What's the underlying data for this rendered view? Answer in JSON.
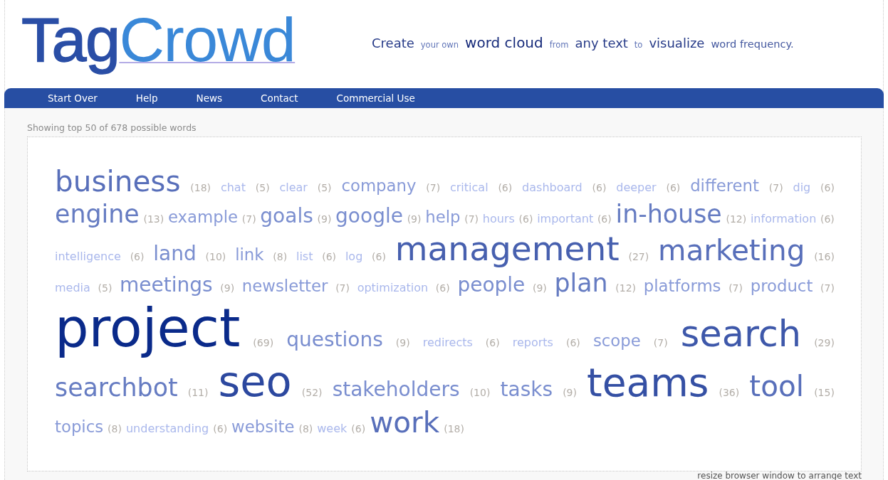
{
  "logo": {
    "parts": [
      "Tag",
      "Crowd"
    ]
  },
  "tagline": [
    {
      "text": "Create",
      "kind": "major"
    },
    {
      "text": "your own",
      "kind": "minor"
    },
    {
      "text": "word cloud",
      "kind": "top"
    },
    {
      "text": "from",
      "kind": "minor"
    },
    {
      "text": "any text",
      "kind": "major"
    },
    {
      "text": "to",
      "kind": "minor"
    },
    {
      "text": "visualize",
      "kind": "major"
    },
    {
      "text": "word frequency.",
      "kind": "mid"
    }
  ],
  "nav": [
    "Start Over",
    "Help",
    "News",
    "Contact",
    "Commercial Use"
  ],
  "summary": "Showing top 50 of 678 possible words",
  "cloud": {
    "lines": [
      {
        "words": [
          {
            "word": "business",
            "count": "(18)",
            "kind": "larger"
          },
          {
            "word": "chat",
            "count": "(5)",
            "kind": "minimal"
          },
          {
            "word": "clear",
            "count": "(5)",
            "kind": "minimal"
          },
          {
            "word": "company",
            "count": "(7)",
            "kind": "small"
          },
          {
            "word": "critical",
            "count": "(6)",
            "kind": "minimal"
          },
          {
            "word": "dashboard",
            "count": "(6)",
            "kind": "minimal"
          },
          {
            "word": "deeper",
            "count": "(6)",
            "kind": "minimal"
          },
          {
            "word": "different",
            "count": "(7)",
            "kind": "small"
          },
          {
            "word": "dig",
            "count": "(6)",
            "kind": "minimal"
          }
        ]
      },
      {
        "words": [
          {
            "word": "engine",
            "count": "(13)",
            "kind": "large"
          },
          {
            "word": "example",
            "count": "(7)",
            "kind": "small"
          },
          {
            "word": "goals",
            "count": "(9)",
            "kind": "medium"
          },
          {
            "word": "google",
            "count": "(9)",
            "kind": "medium"
          },
          {
            "word": "help",
            "count": "(7)",
            "kind": "small"
          },
          {
            "word": "hours",
            "count": "(6)",
            "kind": "minimal"
          },
          {
            "word": "important",
            "count": "(6)",
            "kind": "minimal"
          },
          {
            "word": "in-house",
            "count": "(12)",
            "kind": "large"
          },
          {
            "word": "information",
            "count": "(6)",
            "kind": "minimal"
          }
        ]
      },
      {
        "words": [
          {
            "word": "intelligence",
            "count": "(6)",
            "kind": "minimal"
          },
          {
            "word": "land",
            "count": "(10)",
            "kind": "medium"
          },
          {
            "word": "link",
            "count": "(8)",
            "kind": "small"
          },
          {
            "word": "list",
            "count": "(6)",
            "kind": "minimal"
          },
          {
            "word": "log",
            "count": "(6)",
            "kind": "minimal"
          },
          {
            "word": "management",
            "count": "(27)",
            "kind": "big"
          },
          {
            "word": "marketing",
            "count": "(16)",
            "kind": "larger"
          }
        ]
      },
      {
        "words": [
          {
            "word": "media",
            "count": "(5)",
            "kind": "minimal"
          },
          {
            "word": "meetings",
            "count": "(9)",
            "kind": "medium"
          },
          {
            "word": "newsletter",
            "count": "(7)",
            "kind": "small"
          },
          {
            "word": "optimization",
            "count": "(6)",
            "kind": "minimal"
          },
          {
            "word": "people",
            "count": "(9)",
            "kind": "medium"
          },
          {
            "word": "plan",
            "count": "(12)",
            "kind": "large"
          },
          {
            "word": "platforms",
            "count": "(7)",
            "kind": "small"
          },
          {
            "word": "product",
            "count": "(7)",
            "kind": "small"
          }
        ]
      },
      {
        "words": [
          {
            "word": "project",
            "count": "(69)",
            "kind": "top"
          },
          {
            "word": "questions",
            "count": "(9)",
            "kind": "medium"
          },
          {
            "word": "redirects",
            "count": "(6)",
            "kind": "minimal"
          },
          {
            "word": "reports",
            "count": "(6)",
            "kind": "minimal"
          },
          {
            "word": "scope",
            "count": "(7)",
            "kind": "small"
          },
          {
            "word": "search",
            "count": "(29)",
            "kind": "bigger"
          }
        ]
      },
      {
        "words": [
          {
            "word": "searchbot",
            "count": "(11)",
            "kind": "large"
          },
          {
            "word": "seo",
            "count": "(52)",
            "kind": "giant"
          },
          {
            "word": "stakeholders",
            "count": "(10)",
            "kind": "medium"
          },
          {
            "word": "tasks",
            "count": "(9)",
            "kind": "medium"
          },
          {
            "word": "teams",
            "count": "(36)",
            "kind": "huge"
          },
          {
            "word": "tool",
            "count": "(15)",
            "kind": "larger"
          }
        ]
      },
      {
        "words": [
          {
            "word": "topics",
            "count": "(8)",
            "kind": "small"
          },
          {
            "word": "understanding",
            "count": "(6)",
            "kind": "minimal"
          },
          {
            "word": "website",
            "count": "(8)",
            "kind": "small"
          },
          {
            "word": "week",
            "count": "(6)",
            "kind": "minimal"
          },
          {
            "word": "work",
            "count": "(18)",
            "kind": "larger"
          }
        ]
      }
    ]
  },
  "footer_note": "resize browser window to arrange text"
}
